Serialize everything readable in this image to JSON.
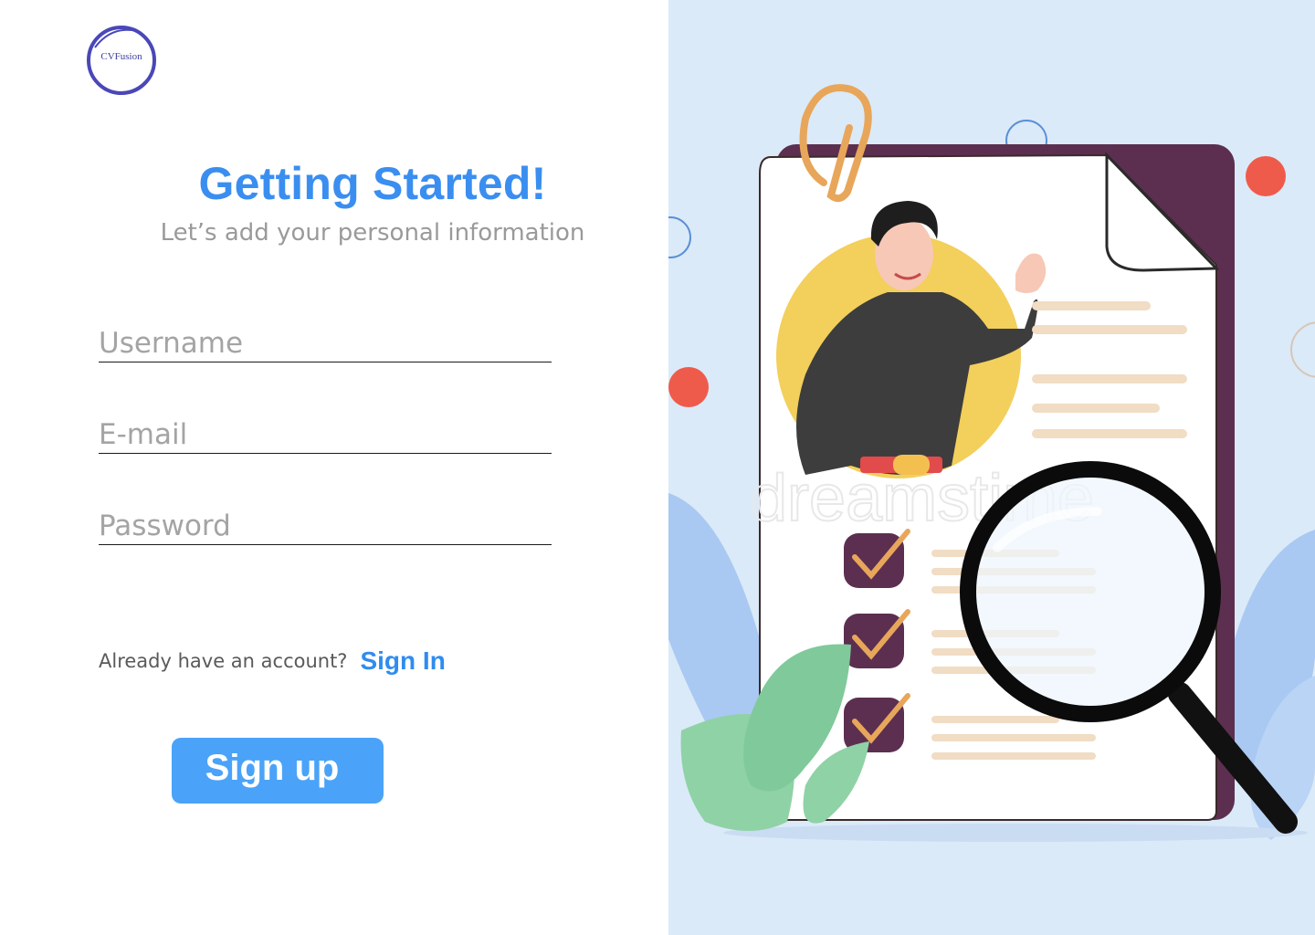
{
  "logo": {
    "text": "CVFusion",
    "icon": "brush-circle-logo"
  },
  "header": {
    "title": "Getting Started!",
    "subtitle": "Let’s add your personal information"
  },
  "form": {
    "username_placeholder": "Username",
    "email_placeholder": "E-mail",
    "password_placeholder": "Password",
    "username_value": "",
    "email_value": "",
    "password_value": ""
  },
  "account": {
    "prompt": "Already have an account?",
    "signin_label": "Sign In"
  },
  "signup": {
    "label": "Sign up"
  },
  "illustration": {
    "watermark": "dreamstime",
    "description_icon": "resume-search-illustration"
  },
  "colors": {
    "accent": "#3a8ef0",
    "button": "#4aa3f8",
    "panel_bg": "#dbeaf8",
    "document_back": "#5c2f50"
  }
}
